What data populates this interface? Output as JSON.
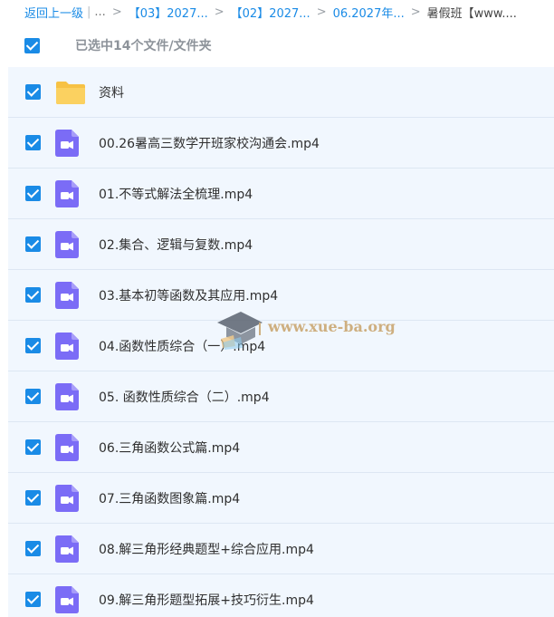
{
  "breadcrumb": {
    "back": "返回上一级",
    "ellipsis": "...",
    "items": [
      "【03】2027...",
      "【02】2027...",
      "06.2027年...",
      "暑假班【www...."
    ]
  },
  "selection": {
    "text": "已选中14个文件/文件夹"
  },
  "files": [
    {
      "name": "资料",
      "type": "folder"
    },
    {
      "name": "00.26暑高三数学开班家校沟通会.mp4",
      "type": "video"
    },
    {
      "name": "01.不等式解法全梳理.mp4",
      "type": "video"
    },
    {
      "name": "02.集合、逻辑与复数.mp4",
      "type": "video"
    },
    {
      "name": "03.基本初等函数及其应用.mp4",
      "type": "video"
    },
    {
      "name": "04.函数性质综合（一）.mp4",
      "type": "video"
    },
    {
      "name": "05. 函数性质综合（二）.mp4",
      "type": "video"
    },
    {
      "name": "06.三角函数公式篇.mp4",
      "type": "video"
    },
    {
      "name": "07.三角函数图象篇.mp4",
      "type": "video"
    },
    {
      "name": "08.解三角形经典题型+综合应用.mp4",
      "type": "video"
    },
    {
      "name": "09.解三角形题型拓展+技巧衍生.mp4",
      "type": "video"
    }
  ],
  "watermark": {
    "text": "www.xue-ba.org"
  },
  "colors": {
    "accent": "#1a8be6",
    "row_bg": "#f1f7fe",
    "folder": "#f7c244",
    "video": "#7b6cf6"
  }
}
